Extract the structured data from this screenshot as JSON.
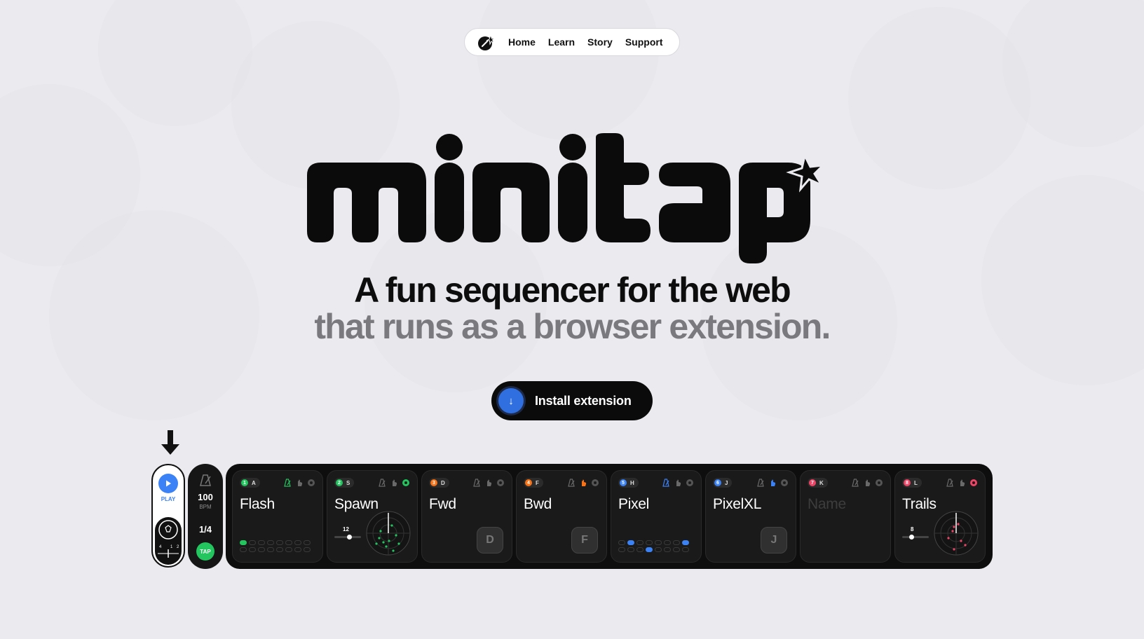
{
  "nav": {
    "links": [
      "Home",
      "Learn",
      "Story",
      "Support"
    ]
  },
  "hero": {
    "logo_text": "minitap",
    "tagline_line1": "A fun sequencer for the web",
    "tagline_line2": "that runs as a browser extension.",
    "install_label": "Install extension"
  },
  "transport": {
    "play_label": "PLAY",
    "dial_ticks": [
      "4",
      "1",
      "2"
    ]
  },
  "tempo": {
    "bpm": "100",
    "bpm_unit": "BPM",
    "division": "1/4",
    "tap_label": "TAP"
  },
  "cards": [
    {
      "num": "1",
      "key": "A",
      "name": "Flash",
      "color": "#22c55e",
      "type": "steps",
      "slider_value": null
    },
    {
      "num": "2",
      "key": "S",
      "name": "Spawn",
      "color": "#22c55e",
      "type": "radar",
      "slider_value": "12"
    },
    {
      "num": "3",
      "key": "D",
      "name": "Fwd",
      "color": "#f97316",
      "type": "key"
    },
    {
      "num": "4",
      "key": "F",
      "name": "Bwd",
      "color": "#f97316",
      "type": "key"
    },
    {
      "num": "5",
      "key": "H",
      "name": "Pixel",
      "color": "#3b82f6",
      "type": "steps"
    },
    {
      "num": "6",
      "key": "J",
      "name": "PixelXL",
      "color": "#3b82f6",
      "type": "key"
    },
    {
      "num": "7",
      "key": "K",
      "name": "Name",
      "color": "#ef4466",
      "type": "empty"
    },
    {
      "num": "8",
      "key": "L",
      "name": "Trails",
      "color": "#ef4466",
      "type": "radar",
      "slider_value": "8"
    }
  ],
  "colors": {
    "background": "#ebebef",
    "accent_blue": "#3b82f6",
    "accent_green": "#22c55e",
    "accent_orange": "#f97316",
    "accent_pink": "#ef4466"
  }
}
